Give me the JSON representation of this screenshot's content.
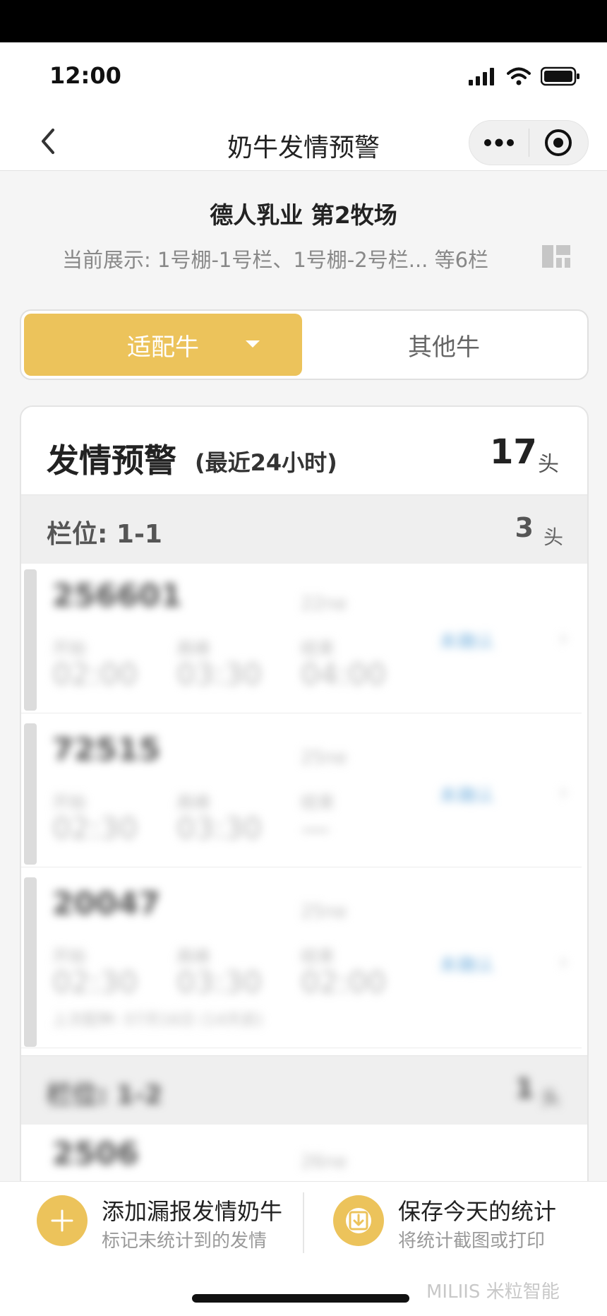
{
  "status_bar": {
    "time": "12:00"
  },
  "nav": {
    "title": "奶牛发情预警",
    "more_icon": "more-dots-icon",
    "close_icon": "target-circle-icon"
  },
  "farm": {
    "title": "德人乳业 第2牧场",
    "scope": "当前展示: 1号棚-1号栏、1号棚-2号栏... 等6栏"
  },
  "segment": {
    "active_label": "适配牛",
    "other_label": "其他牛"
  },
  "warning": {
    "title": "发情预警",
    "subtitle": "(最近24小时)",
    "count": "17",
    "unit": "头"
  },
  "stalls": [
    {
      "label": "栏位: 1-1",
      "count": "3",
      "unit": "头",
      "cows": [
        {
          "id": "256601",
          "age": "22ne",
          "labels": [
            "开始",
            "高峰",
            "结束"
          ],
          "values": [
            "02:00",
            "03:30",
            "04:00"
          ],
          "link": "未确认",
          "note": ""
        },
        {
          "id": "72515",
          "age": "25ne",
          "labels": [
            "开始",
            "高峰",
            "结束"
          ],
          "values": [
            "02:30",
            "03:30",
            "—"
          ],
          "link": "未确认",
          "note": ""
        },
        {
          "id": "20047",
          "age": "25ne",
          "labels": [
            "开始",
            "高峰",
            "结束"
          ],
          "values": [
            "02:30",
            "03:30",
            "02:00"
          ],
          "link": "未确认",
          "note": "上次配种: 07月16日 (14天前)"
        }
      ]
    },
    {
      "label": "栏位: 1-2",
      "count": "1",
      "unit": "头",
      "cows": [
        {
          "id": "2506",
          "age": "26ne",
          "labels": [
            "",
            "",
            ""
          ],
          "values": [
            "",
            "",
            ""
          ],
          "link": "",
          "note": ""
        }
      ]
    }
  ],
  "footer": {
    "add": {
      "title": "添加漏报发情奶牛",
      "subtitle": "标记未统计到的发情",
      "icon": "plus-icon"
    },
    "save": {
      "title": "保存今天的统计",
      "subtitle": "将统计截图或打印",
      "icon": "download-icon"
    }
  },
  "watermark": "MILIIS 米粒智能",
  "colors": {
    "accent": "#ecc35b",
    "link": "#7fb6e0"
  }
}
